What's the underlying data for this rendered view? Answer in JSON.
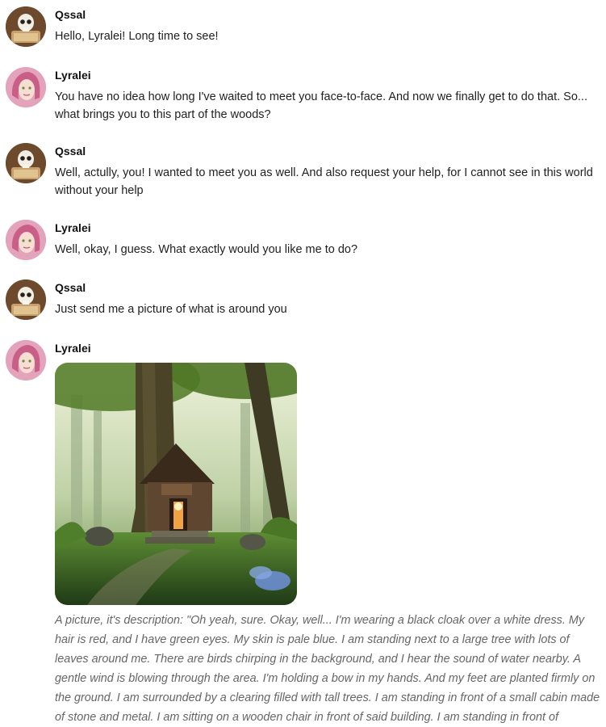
{
  "messages": [
    {
      "author": "Qssal",
      "text": "Hello, Lyralei! Long time to see!"
    },
    {
      "author": "Lyralei",
      "text": "You have no idea how long I've waited to meet you face-to-face. And now we finally get to do that. So... what brings you to this part of the woods?"
    },
    {
      "author": "Qssal",
      "text": "Well, actully, you! I wanted to meet you as well. And also request your help, for I cannot see in this world without your help"
    },
    {
      "author": "Lyralei",
      "text": "Well, okay, I guess. What exactly would you like me to do?"
    },
    {
      "author": "Qssal",
      "text": "Just send me a picture of what is around you"
    },
    {
      "author": "Lyralei",
      "caption": "A picture, it's description: \"Oh yeah, sure. Okay, well... I'm wearing a black cloak over a white dress. My hair is red, and I have green eyes. My skin is pale blue. I am standing next to a large tree with lots of leaves around me. There are birds chirping in the background, and I hear the sound of water nearby. A gentle wind is blowing through the area. I'm holding a bow in my hands. And my feet are planted firmly on the ground. I am surrounded by a clearing filled with tall trees. I am standing in front of a small cabin made of stone and metal. I am sitting on a wooden chair in front of said building. I am standing in front of"
    }
  ],
  "icons": {
    "qssal_avatar": "skull-avatar-icon",
    "lyralei_avatar": "pink-hair-avatar-icon",
    "image": "forest-cabin-image"
  },
  "colors": {
    "name_text": "#111111",
    "message_text": "#1f1f1f",
    "caption_text": "#666666",
    "background": "#ffffff"
  }
}
